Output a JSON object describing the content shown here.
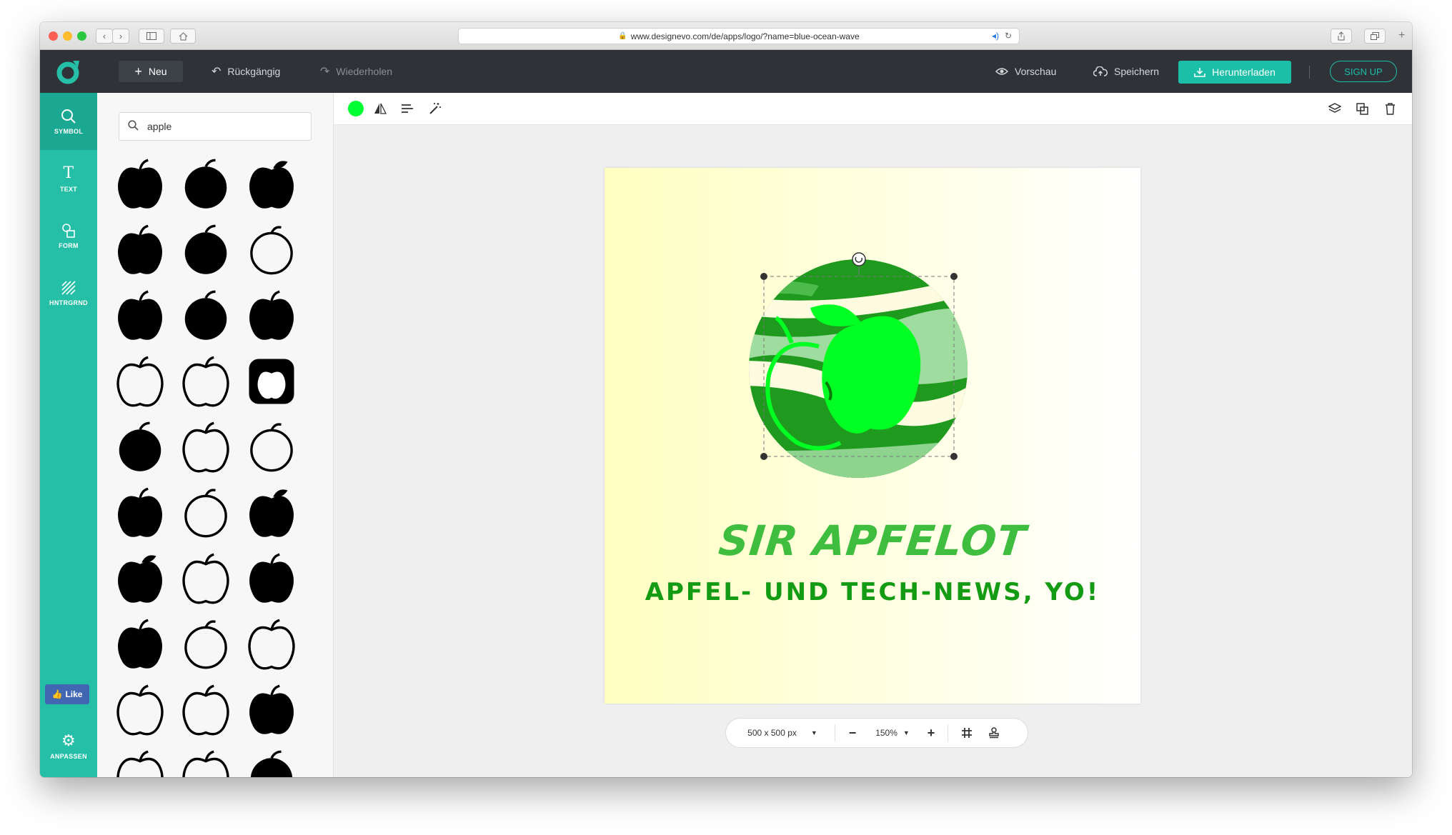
{
  "browser": {
    "url": "www.designevo.com/de/apps/logo/?name=blue-ocean-wave"
  },
  "toolbar": {
    "new_label": "Neu",
    "undo_label": "Rückgängig",
    "redo_label": "Wiederholen",
    "preview_label": "Vorschau",
    "save_label": "Speichern",
    "download_label": "Herunterladen",
    "signup_label": "SIGN UP"
  },
  "sidebar": {
    "items": [
      {
        "label": "SYMBOL",
        "icon": "search-icon"
      },
      {
        "label": "TEXT",
        "icon": "text-icon"
      },
      {
        "label": "FORM",
        "icon": "shapes-icon"
      },
      {
        "label": "HNTRGRND",
        "icon": "background-icon"
      }
    ],
    "like_label": "Like",
    "settings_label": "ANPASSEN"
  },
  "symbol_panel": {
    "search_value": "apple",
    "search_icon": "search-icon",
    "symbol_count": 30
  },
  "canvas": {
    "logo_title": "SIR APFELOT",
    "logo_subtitle": "APFEL- UND TECH-NEWS, YO!",
    "selected_color": "#00ff33",
    "title_color": "#3fbd3f",
    "subtitle_color": "#149b14"
  },
  "bottom_bar": {
    "size_label": "500 x 500 px",
    "zoom_label": "150%"
  },
  "colors": {
    "accent": "#25bfa7",
    "topbar": "#2f3338"
  }
}
